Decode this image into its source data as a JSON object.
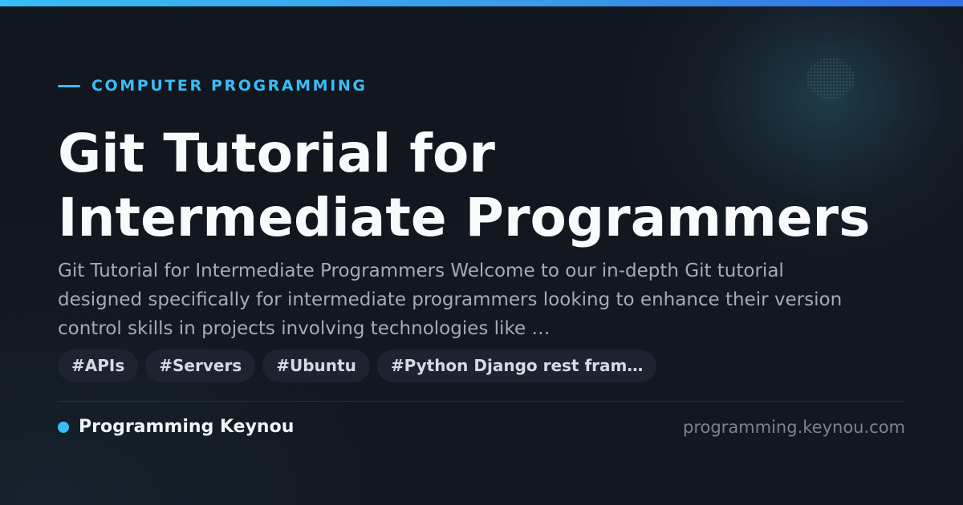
{
  "category": "COMPUTER PROGRAMMING",
  "title": {
    "line1": "Git Tutorial for",
    "line2": "Intermediate Programmers"
  },
  "description": "Git Tutorial for Intermediate Programmers Welcome to our in-depth Git tutorial designed specifically for intermediate programmers looking to enhance their version control skills in projects involving technologies like …",
  "tags": [
    "#APIs",
    "#Servers",
    "#Ubuntu",
    "#Python Django rest fram…"
  ],
  "footer": {
    "brand": "Programming Keynou",
    "domain": "programming.keynou.com"
  },
  "colors": {
    "accent": "#38bdf8",
    "background": "#12161e",
    "title": "#f8fafc",
    "description": "#a3acb9",
    "tag_background": "#1d2430"
  }
}
